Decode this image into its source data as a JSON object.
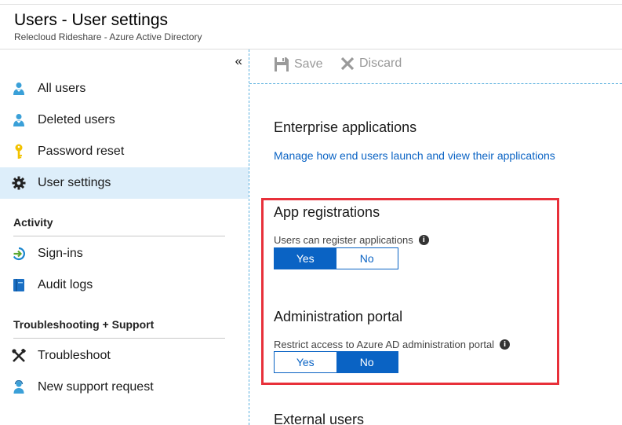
{
  "header": {
    "title": "Users - User settings",
    "subtitle": "Relecloud Rideshare - Azure Active Directory"
  },
  "sidebar": {
    "collapse_glyph": "«",
    "items": [
      {
        "label": "All users",
        "icon": "user-icon"
      },
      {
        "label": "Deleted users",
        "icon": "user-icon"
      },
      {
        "label": "Password reset",
        "icon": "key-icon"
      },
      {
        "label": "User settings",
        "icon": "gear-icon",
        "selected": true
      }
    ],
    "activity": {
      "title": "Activity",
      "items": [
        {
          "label": "Sign-ins",
          "icon": "sign-in-icon"
        },
        {
          "label": "Audit logs",
          "icon": "audit-log-icon"
        }
      ]
    },
    "support": {
      "title": "Troubleshooting + Support",
      "items": [
        {
          "label": "Troubleshoot",
          "icon": "wrench-icon"
        },
        {
          "label": "New support request",
          "icon": "support-person-icon"
        }
      ]
    }
  },
  "toolbar": {
    "save_label": "Save",
    "discard_label": "Discard"
  },
  "main": {
    "enterprise": {
      "heading": "Enterprise applications",
      "link": "Manage how end users launch and view their applications"
    },
    "app_registrations": {
      "heading": "App registrations",
      "label": "Users can register applications",
      "yes": "Yes",
      "no": "No",
      "selected": "Yes"
    },
    "admin_portal": {
      "heading": "Administration portal",
      "label": "Restrict access to Azure AD administration portal",
      "yes": "Yes",
      "no": "No",
      "selected": "No"
    },
    "external_users": {
      "heading": "External users"
    }
  },
  "colors": {
    "accent": "#0a63c4",
    "selected_bg": "#ddeefa",
    "highlight_box": "#e8303a"
  }
}
